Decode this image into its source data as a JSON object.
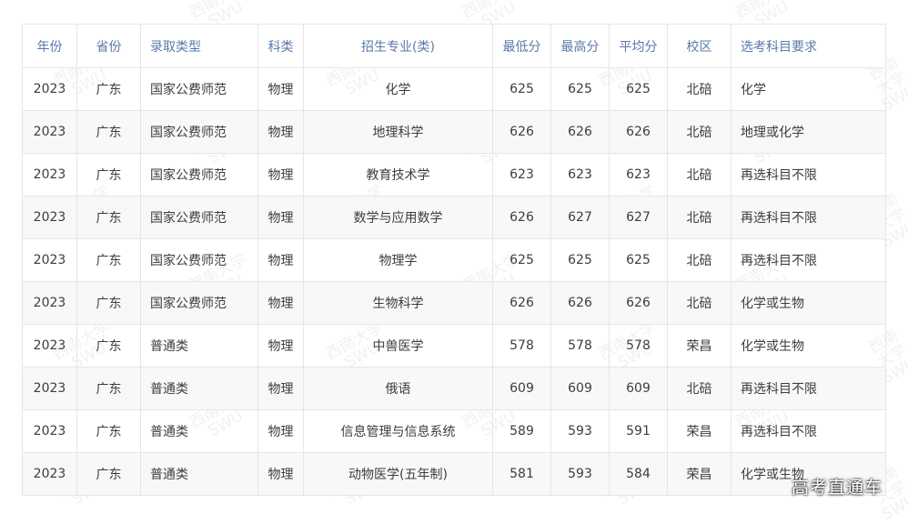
{
  "table": {
    "headers": [
      "年份",
      "省份",
      "录取类型",
      "科类",
      "招生专业(类)",
      "最低分",
      "最高分",
      "平均分",
      "校区",
      "选考科目要求"
    ],
    "rows": [
      [
        "2023",
        "广东",
        "国家公费师范",
        "物理",
        "化学",
        "625",
        "625",
        "625",
        "北碚",
        "化学"
      ],
      [
        "2023",
        "广东",
        "国家公费师范",
        "物理",
        "地理科学",
        "626",
        "626",
        "626",
        "北碚",
        "地理或化学"
      ],
      [
        "2023",
        "广东",
        "国家公费师范",
        "物理",
        "教育技术学",
        "623",
        "623",
        "623",
        "北碚",
        "再选科目不限"
      ],
      [
        "2023",
        "广东",
        "国家公费师范",
        "物理",
        "数学与应用数学",
        "626",
        "627",
        "627",
        "北碚",
        "再选科目不限"
      ],
      [
        "2023",
        "广东",
        "国家公费师范",
        "物理",
        "物理学",
        "625",
        "625",
        "625",
        "北碚",
        "再选科目不限"
      ],
      [
        "2023",
        "广东",
        "国家公费师范",
        "物理",
        "生物科学",
        "626",
        "626",
        "626",
        "北碚",
        "化学或生物"
      ],
      [
        "2023",
        "广东",
        "普通类",
        "物理",
        "中兽医学",
        "578",
        "578",
        "578",
        "荣昌",
        "化学或生物"
      ],
      [
        "2023",
        "广东",
        "普通类",
        "物理",
        "俄语",
        "609",
        "609",
        "609",
        "北碚",
        "再选科目不限"
      ],
      [
        "2023",
        "广东",
        "普通类",
        "物理",
        "信息管理与信息系统",
        "589",
        "593",
        "591",
        "荣昌",
        "再选科目不限"
      ],
      [
        "2023",
        "广东",
        "普通类",
        "物理",
        "动物医学(五年制)",
        "581",
        "593",
        "584",
        "荣昌",
        "化学或生物"
      ]
    ]
  },
  "watermark": {
    "line1": "西南大学",
    "line2": "SWU"
  },
  "brand": {
    "text": "高考直通车"
  }
}
